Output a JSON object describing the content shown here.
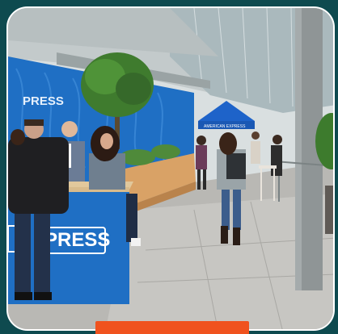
{
  "photo": {
    "booth_brand_text": "PRESS",
    "counter_brand_text": "PRESS",
    "tent_text": "AMERICAN EXPRESS"
  },
  "colors": {
    "background": "#0e4a4f",
    "brand_blue": "#1f6fc4",
    "cta_orange": "#f0521e"
  }
}
